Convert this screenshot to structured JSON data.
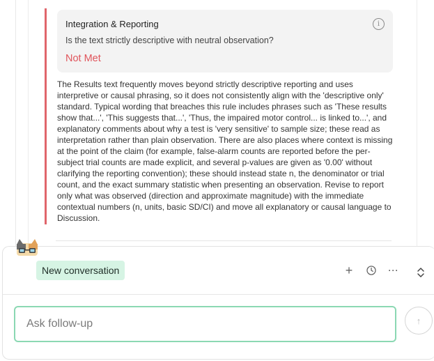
{
  "criterion": {
    "title": "Integration & Reporting",
    "question": "Is the text strictly descriptive with neutral observation?",
    "status": "Not Met",
    "status_color": "#e0555c",
    "accent_color": "#e0656b",
    "info_icon": "i",
    "explanation": "The Results text frequently moves beyond strictly descriptive reporting and uses interpretive or causal phrasing, so it does not consistently align with the 'descriptive only' standard. Typical wording that breaches this rule includes phrases such as 'These results show that...', 'This suggests that...', 'Thus, the impaired motor control... is linked to...', and explanatory comments about why a test is 'very sensitive' to sample size; these read as interpretation rather than plain observation. There are also places where context is missing at the point of the claim (for example, false-alarm counts are reported before the per-subject trial counts are made explicit, and several p-values are given as '0.00' without clarifying the reporting convention); these should instead state n, the denominator or trial count, and the exact summary statistic when presenting an observation. Revise to report only what was observed (direction and approximate magnitude) with the immediate contextual numbers (n, units, basic SD/CI) and move all explanatory or causal language to Discussion."
  },
  "chat": {
    "tab_label": "New conversation",
    "tab_color": "#d6f4e4",
    "icons": {
      "plus": "+",
      "history": "◷",
      "more": "···",
      "collapse": "⌃⌄"
    },
    "input_placeholder": "Ask follow-up",
    "send_icon": "↑"
  }
}
